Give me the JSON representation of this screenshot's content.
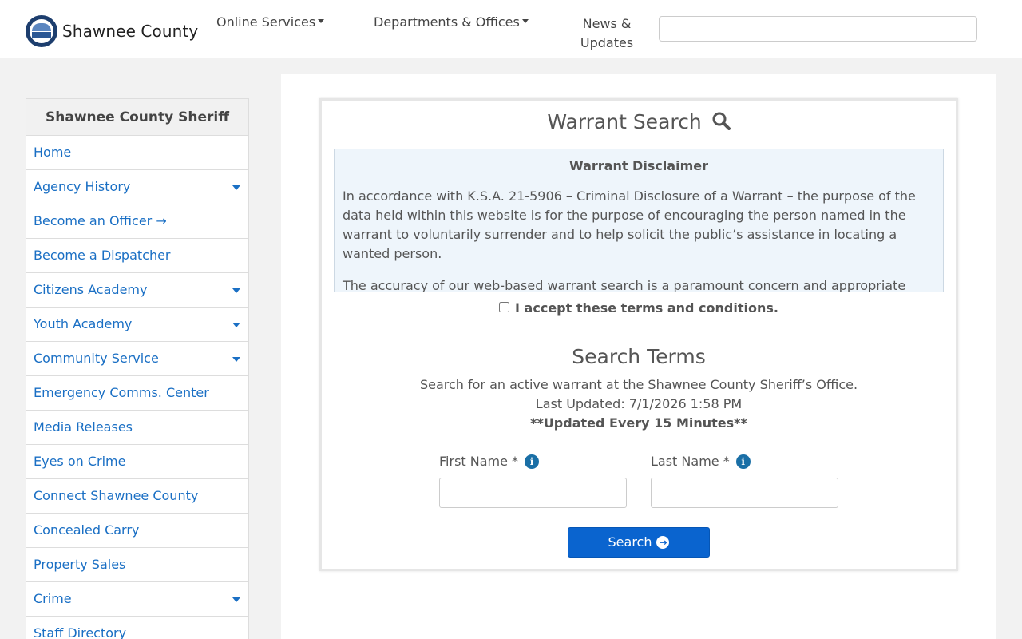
{
  "header": {
    "logo_text": "Shawnee County",
    "nav": {
      "online_services": "Online Services",
      "departments": "Departments & Offices",
      "news_line1": "News &",
      "news_line2": "Updates"
    },
    "search_value": ""
  },
  "sidebar": {
    "title": "Shawnee County Sheriff",
    "items": [
      {
        "label": "Home",
        "has_dropdown": false
      },
      {
        "label": "Agency History",
        "has_dropdown": true
      },
      {
        "label": "Become an Officer →",
        "has_dropdown": false
      },
      {
        "label": "Become a Dispatcher",
        "has_dropdown": false
      },
      {
        "label": "Citizens Academy",
        "has_dropdown": true
      },
      {
        "label": "Youth Academy",
        "has_dropdown": true
      },
      {
        "label": "Community Service",
        "has_dropdown": true
      },
      {
        "label": "Emergency Comms. Center",
        "has_dropdown": false
      },
      {
        "label": "Media Releases",
        "has_dropdown": false
      },
      {
        "label": "Eyes on Crime",
        "has_dropdown": false
      },
      {
        "label": "Connect Shawnee County",
        "has_dropdown": false
      },
      {
        "label": "Concealed Carry",
        "has_dropdown": false
      },
      {
        "label": "Property Sales",
        "has_dropdown": false
      },
      {
        "label": "Crime",
        "has_dropdown": true
      },
      {
        "label": "Staff Directory",
        "has_dropdown": false
      }
    ]
  },
  "warrant": {
    "title": "Warrant Search",
    "search_icon": "search-icon",
    "disclaimer_heading": "Warrant Disclaimer",
    "disclaimer_p1": "In accordance with K.S.A. 21-5906 – Criminal Disclosure of a Warrant – the purpose of the data held within this website is for the purpose of encouraging the person named in the warrant to voluntarily surrender and to help solicit the public’s assistance in locating a wanted person.",
    "disclaimer_p2": "The accuracy of our web-based warrant search is a paramount concern and appropriate",
    "accept_label": "I accept these terms and conditions.",
    "accept_checked": false,
    "terms_title": "Search Terms",
    "terms_desc": "Search for an active warrant at the Shawnee County Sheriff’s Office.",
    "last_updated": "Last Updated: 7/1/2026 1:58 PM",
    "update_freq": "**Updated Every 15 Minutes**",
    "first_name_label": "First Name *",
    "last_name_label": "Last Name *",
    "first_name_value": "",
    "last_name_value": "",
    "search_button": "Search",
    "info_icon": "info-icon",
    "arrow_icon": "arrow-circle-right-icon"
  },
  "colors": {
    "link_blue": "#1a6fc4",
    "button_blue": "#0a64cf",
    "disclaimer_bg": "#eef5fb"
  }
}
